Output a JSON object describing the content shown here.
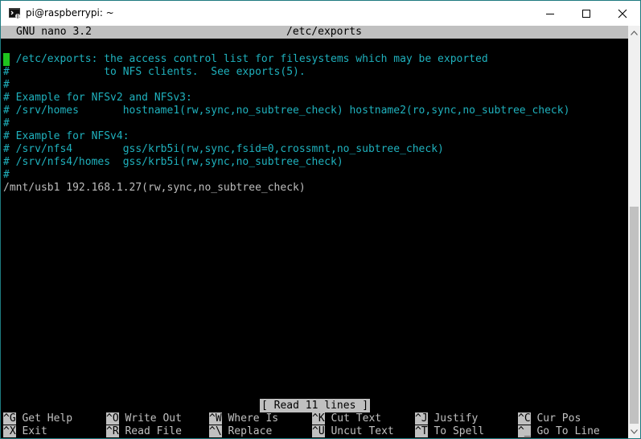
{
  "window": {
    "title": "pi@raspberrypi: ~"
  },
  "nano": {
    "version": "GNU nano 3.2",
    "filename": "/etc/exports",
    "lines": [
      {
        "text": "# /etc/exports: the access control list for filesystems which may be exported",
        "comment": true
      },
      {
        "text": "#               to NFS clients.  See exports(5).",
        "comment": true
      },
      {
        "text": "#",
        "comment": true
      },
      {
        "text": "# Example for NFSv2 and NFSv3:",
        "comment": true
      },
      {
        "text": "# /srv/homes       hostname1(rw,sync,no_subtree_check) hostname2(ro,sync,no_subtree_check)",
        "comment": true
      },
      {
        "text": "#",
        "comment": true
      },
      {
        "text": "# Example for NFSv4:",
        "comment": true
      },
      {
        "text": "# /srv/nfs4        gss/krb5i(rw,sync,fsid=0,crossmnt,no_subtree_check)",
        "comment": true
      },
      {
        "text": "# /srv/nfs4/homes  gss/krb5i(rw,sync,no_subtree_check)",
        "comment": true
      },
      {
        "text": "#",
        "comment": true
      },
      {
        "text": "/mnt/usb1 192.168.1.27(rw,sync,no_subtree_check)",
        "comment": false
      }
    ],
    "status": "[ Read 11 lines ]",
    "shortcuts_row1": [
      {
        "key": "^G",
        "label": "Get Help"
      },
      {
        "key": "^O",
        "label": "Write Out"
      },
      {
        "key": "^W",
        "label": "Where Is"
      },
      {
        "key": "^K",
        "label": "Cut Text"
      },
      {
        "key": "^J",
        "label": "Justify"
      },
      {
        "key": "^C",
        "label": "Cur Pos"
      }
    ],
    "shortcuts_row2": [
      {
        "key": "^X",
        "label": "Exit"
      },
      {
        "key": "^R",
        "label": "Read File"
      },
      {
        "key": "^\\",
        "label": "Replace"
      },
      {
        "key": "^U",
        "label": "Uncut Text"
      },
      {
        "key": "^T",
        "label": "To Spell"
      },
      {
        "key": "^_",
        "label": "Go To Line"
      }
    ]
  },
  "colors": {
    "comment": "#1fb1bd",
    "text": "#bdbdbd",
    "cursor": "#1ec41e",
    "bar": "#c0c0c0"
  },
  "icons": {
    "app": "terminal-icon",
    "minimize": "minimize-icon",
    "maximize": "maximize-icon",
    "close": "close-icon"
  }
}
